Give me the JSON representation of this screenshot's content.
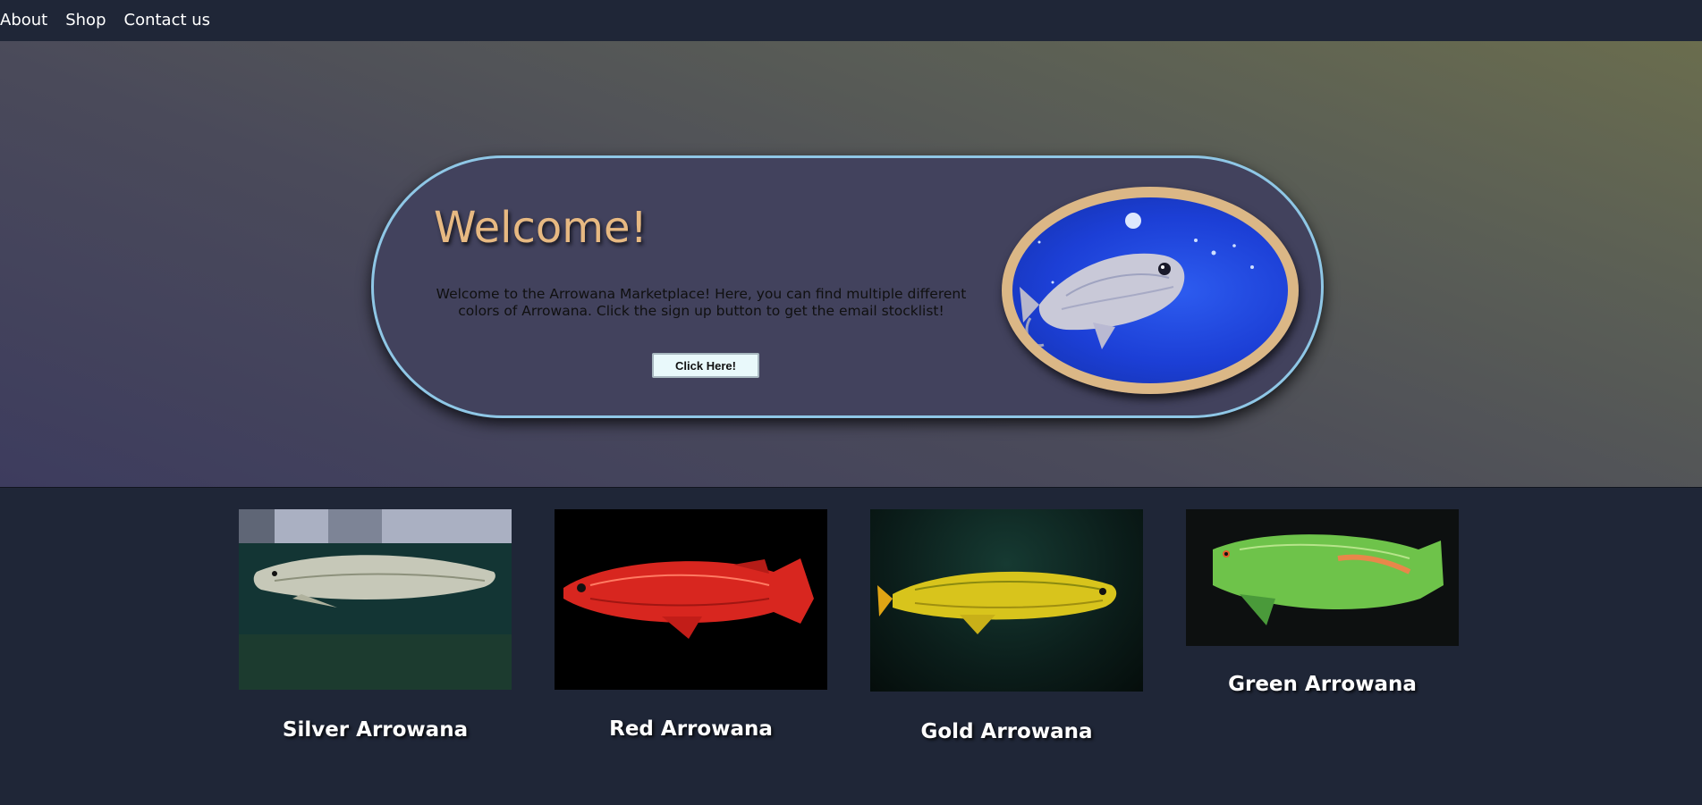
{
  "nav": {
    "items": [
      {
        "label": "About"
      },
      {
        "label": "Shop"
      },
      {
        "label": "Contact us"
      }
    ]
  },
  "hero": {
    "heading": "Welcome!",
    "text": "Welcome to the Arrowana Marketplace! Here, you can find multiple different colors of Arrowana. Click the sign up button to get the email stocklist!",
    "button_label": "Click Here!",
    "image_icon": "arrowana-photo"
  },
  "products": [
    {
      "name": "Silver Arrowana",
      "image_icon": "silver-arrowana-photo"
    },
    {
      "name": "Red Arrowana",
      "image_icon": "red-arrowana-photo"
    },
    {
      "name": "Gold Arrowana",
      "image_icon": "gold-arrowana-photo"
    },
    {
      "name": "Green Arrowana",
      "image_icon": "green-arrowana-photo"
    }
  ],
  "colors": {
    "nav_bg": "#1f2637",
    "page_bg": "#1f2637",
    "pill_bg": "#42425d",
    "pill_border": "#8fc7e6",
    "heading": "#e7b982",
    "frame": "#dbb786",
    "button_bg": "#e9f9fb"
  }
}
